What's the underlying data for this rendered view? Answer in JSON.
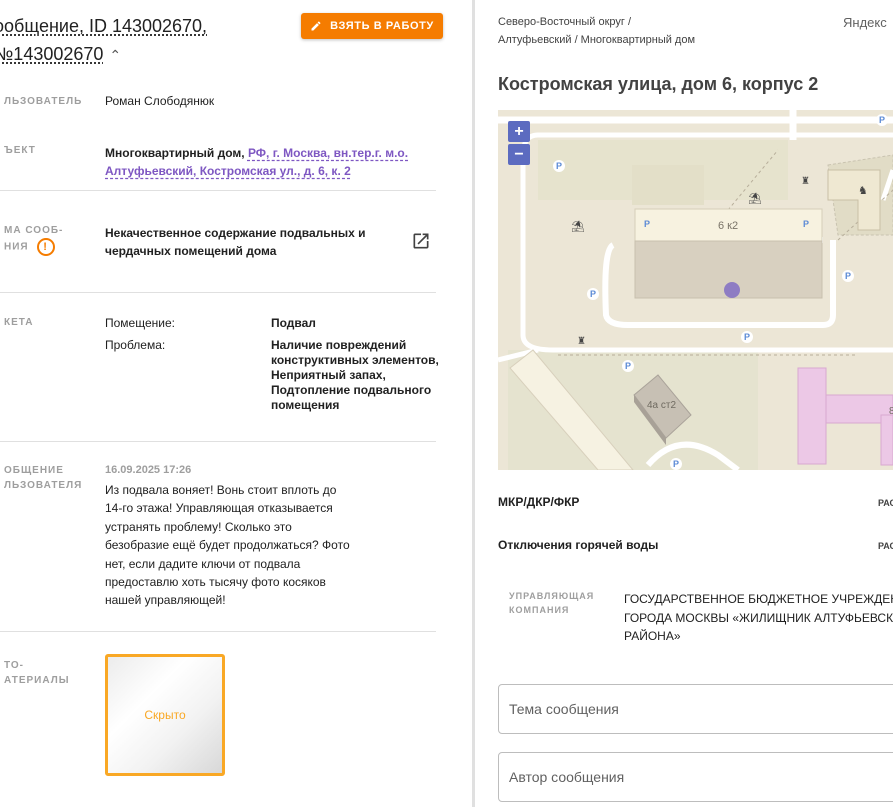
{
  "message": {
    "title_line1": "ообщение, ID 143002670,",
    "title_line2": "№143002670",
    "take_button": "ВЗЯТЬ В РАБОТУ",
    "fields": {
      "user_label": "ЛЬЗОВАТЕЛЬ",
      "user_value": "Роман Слободянюк",
      "object_label": "ЪЕКТ",
      "object_type": "Многоквартирный дом,",
      "object_link": "РФ, г. Москва, вн.тер.г. м.о. Алтуфьевский, Костромская ул., д. 6, к. 2",
      "topic_label_1": "МА СООБ-",
      "topic_label_2": "НИЯ",
      "topic_value": "Некачественное содержание подвальных и чердачных помещений дома",
      "ticket_label": "КЕТА",
      "premises_key": "Помещение:",
      "premises_value": "Подвал",
      "problem_key": "Проблема:",
      "problem_value": "Наличие повреждений конструктивных элементов, Неприятный запах, Подтопление подвального помещения",
      "user_message_label_1": "ОБЩЕНИЕ",
      "user_message_label_2": "ЛЬЗОВАТЕЛЯ",
      "message_date": "16.09.2025 17:26",
      "message_text": "Из подвала воняет! Вонь стоит вплоть до 14-го этажа! Управляющая отказывается устранять проблему! Сколько это безобразие ещё будет продолжаться? Фото нет, если дадите ключи от подвала предоставлю хоть тысячу фото косяков нашей управляющей!",
      "photo_label_1": "ТО-",
      "photo_label_2": "АТЕРИАЛЫ",
      "photo_hidden": "Скрыто"
    }
  },
  "location": {
    "breadcrumb_line1": "Северо-Восточный округ /",
    "breadcrumb_line2": "Алтуфьевский / Многоквартирный дом",
    "yandex": "Яндекс",
    "address": "Костромская улица, дом 6, корпус 2",
    "map": {
      "building_label": "6 к2",
      "building2_label": "4а ст2",
      "zoom_in": "+",
      "zoom_out": "−",
      "partial_label": "8"
    },
    "rows": [
      {
        "label": "МКР/ДКР/ФКР",
        "right": "РАС"
      },
      {
        "label": "Отключения горячей воды",
        "right": "РАС"
      }
    ],
    "management_label_1": "УПРАВЛЯЮЩАЯ",
    "management_label_2": "КОМПАНИЯ",
    "management_value": "ГОСУДАРСТВЕННОЕ БЮДЖЕТНОЕ УЧРЕЖДЕНИ ГОРОДА МОСКВЫ «ЖИЛИЩНИК АЛТУФЬЕВСК РАЙОНА»",
    "topic_placeholder": "Тема сообщения",
    "author_placeholder": "Автор сообщения"
  },
  "colors": {
    "accent": "#f57c00",
    "link": "#7e57c2",
    "map_bg": "#ede7d9",
    "marker": "#8e7cc3"
  }
}
